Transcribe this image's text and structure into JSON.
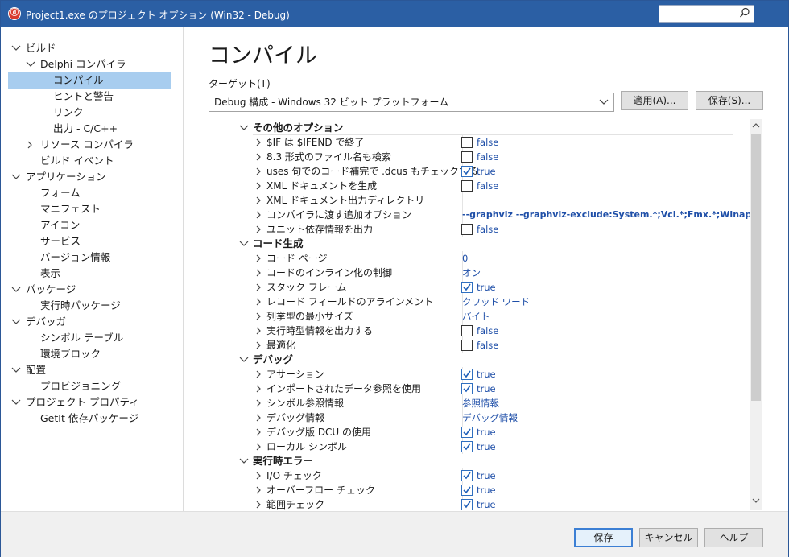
{
  "window": {
    "title": "Project1.exe のプロジェクト オプション  (Win32 - Debug)"
  },
  "sidebar": {
    "items": [
      {
        "label": "ビルド",
        "level": 0,
        "expander": "expanded"
      },
      {
        "label": "Delphi コンパイラ",
        "level": 1,
        "expander": "expanded"
      },
      {
        "label": "コンパイル",
        "level": 2,
        "expander": "none",
        "selected": true
      },
      {
        "label": "ヒントと警告",
        "level": 2,
        "expander": "none"
      },
      {
        "label": "リンク",
        "level": 2,
        "expander": "none"
      },
      {
        "label": "出力 - C/C++",
        "level": 2,
        "expander": "none"
      },
      {
        "label": "リソース コンパイラ",
        "level": 1,
        "expander": "collapsed"
      },
      {
        "label": "ビルド イベント",
        "level": 1,
        "expander": "none"
      },
      {
        "label": "アプリケーション",
        "level": 0,
        "expander": "expanded"
      },
      {
        "label": "フォーム",
        "level": 1,
        "expander": "none"
      },
      {
        "label": "マニフェスト",
        "level": 1,
        "expander": "none"
      },
      {
        "label": "アイコン",
        "level": 1,
        "expander": "none"
      },
      {
        "label": "サービス",
        "level": 1,
        "expander": "none"
      },
      {
        "label": "バージョン情報",
        "level": 1,
        "expander": "none"
      },
      {
        "label": "表示",
        "level": 1,
        "expander": "none"
      },
      {
        "label": "パッケージ",
        "level": 0,
        "expander": "expanded"
      },
      {
        "label": "実行時パッケージ",
        "level": 1,
        "expander": "none"
      },
      {
        "label": "デバッガ",
        "level": 0,
        "expander": "expanded"
      },
      {
        "label": "シンボル テーブル",
        "level": 1,
        "expander": "none"
      },
      {
        "label": "環境ブロック",
        "level": 1,
        "expander": "none"
      },
      {
        "label": "配置",
        "level": 0,
        "expander": "expanded"
      },
      {
        "label": "プロビジョニング",
        "level": 1,
        "expander": "none"
      },
      {
        "label": "プロジェクト プロパティ",
        "level": 0,
        "expander": "expanded"
      },
      {
        "label": "GetIt 依存パッケージ",
        "level": 1,
        "expander": "none"
      }
    ]
  },
  "main": {
    "heading": "コンパイル",
    "target_label": "ターゲット(T)",
    "target_value": "Debug 構成 - Windows 32 ビット プラットフォーム",
    "apply_button": "適用(A)...",
    "save_button": "保存(S)..."
  },
  "options": [
    {
      "type": "category",
      "label": "その他のオプション"
    },
    {
      "type": "bool",
      "label": "$IF は $IFEND で終了",
      "value": "false",
      "checked": false
    },
    {
      "type": "bool",
      "label": "8.3 形式のファイル名も検索",
      "value": "false",
      "checked": false
    },
    {
      "type": "bool",
      "label": "uses 句でのコード補完で .dcus もチェックする",
      "value": "true",
      "checked": true
    },
    {
      "type": "bool",
      "label": "XML ドキュメントを生成",
      "value": "false",
      "checked": false
    },
    {
      "type": "text",
      "label": "XML ドキュメント出力ディレクトリ",
      "value": ""
    },
    {
      "type": "text",
      "label": "コンパイラに渡す追加オプション",
      "value": "--graphviz --graphviz-exclude:System.*;Vcl.*;Fmx.*;Winapi.*",
      "bold": true
    },
    {
      "type": "bool",
      "label": "ユニット依存情報を出力",
      "value": "false",
      "checked": false
    },
    {
      "type": "category",
      "label": "コード生成"
    },
    {
      "type": "text",
      "label": "コード ページ",
      "value": "0"
    },
    {
      "type": "text",
      "label": "コードのインライン化の制御",
      "value": "オン"
    },
    {
      "type": "bool",
      "label": "スタック フレーム",
      "value": "true",
      "checked": true
    },
    {
      "type": "text",
      "label": "レコード フィールドのアラインメント",
      "value": "クワッド ワード"
    },
    {
      "type": "text",
      "label": "列挙型の最小サイズ",
      "value": "バイト"
    },
    {
      "type": "bool",
      "label": "実行時型情報を出力する",
      "value": "false",
      "checked": false
    },
    {
      "type": "bool",
      "label": "最適化",
      "value": "false",
      "checked": false
    },
    {
      "type": "category",
      "label": "デバッグ"
    },
    {
      "type": "bool",
      "label": "アサーション",
      "value": "true",
      "checked": true
    },
    {
      "type": "bool",
      "label": "インポートされたデータ参照を使用",
      "value": "true",
      "checked": true
    },
    {
      "type": "text",
      "label": "シンボル参照情報",
      "value": "参照情報"
    },
    {
      "type": "text",
      "label": "デバッグ情報",
      "value": "デバッグ情報"
    },
    {
      "type": "bool",
      "label": "デバッグ版 DCU の使用",
      "value": "true",
      "checked": true
    },
    {
      "type": "bool",
      "label": "ローカル シンボル",
      "value": "true",
      "checked": true
    },
    {
      "type": "category",
      "label": "実行時エラー"
    },
    {
      "type": "bool",
      "label": "I/O チェック",
      "value": "true",
      "checked": true
    },
    {
      "type": "bool",
      "label": "オーバーフロー チェック",
      "value": "true",
      "checked": true
    },
    {
      "type": "bool",
      "label": "範囲チェック",
      "value": "true",
      "checked": true
    }
  ],
  "footer": {
    "save": "保存",
    "cancel": "キャンセル",
    "help": "ヘルプ"
  },
  "colors": {
    "titlebar": "#2b5fa4",
    "selection": "#a8cdef",
    "value_text": "#1f4fa8"
  }
}
